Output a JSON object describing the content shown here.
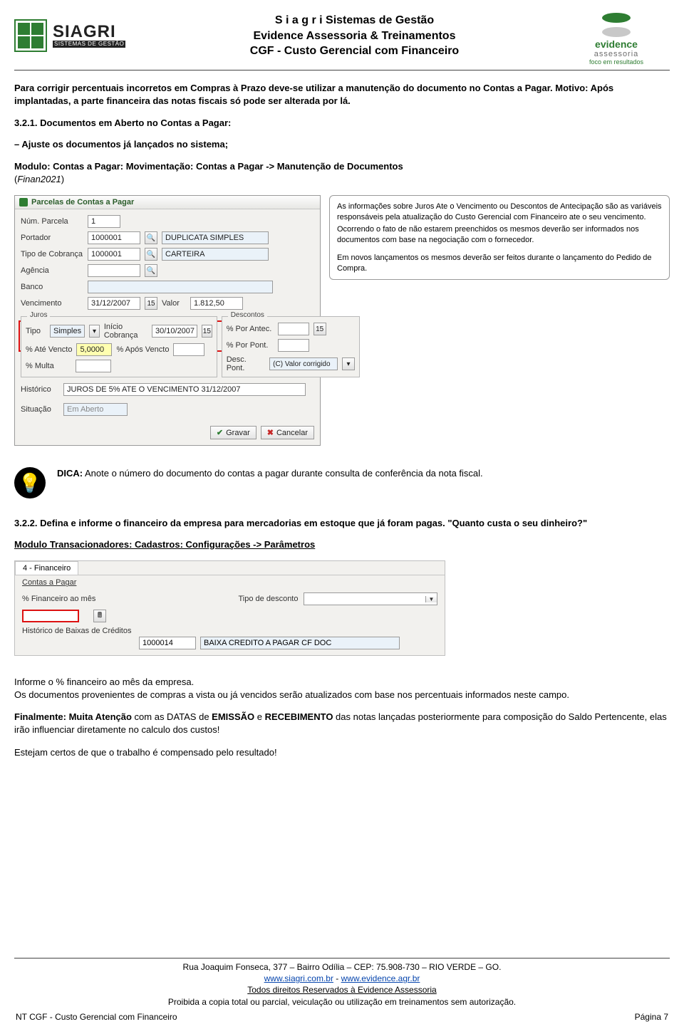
{
  "header": {
    "siagri_name": "SIAGRI",
    "siagri_sub": "SISTEMAS DE GESTÃO",
    "line1": "S i a g r i Sistemas de Gestão",
    "line2": "Evidence Assessoria & Treinamentos",
    "line3": "CGF - Custo Gerencial com Financeiro",
    "evidence_name": "evidence",
    "evidence_sub": "assessoria",
    "evidence_tag": "foco em resultados"
  },
  "intro": {
    "para1": "Para corrigir percentuais incorretos em Compras à Prazo deve-se utilizar a manutenção do documento no Contas a Pagar. Motivo: Após implantadas, a parte financeira das notas fiscais só pode ser alterada por lá."
  },
  "sec321": {
    "title": "3.2.1. Documentos em Aberto no Contas a Pagar:",
    "dash": "– Ajuste os documentos já lançados no sistema;",
    "nav_pre": "Modulo: Contas a Pagar: Movimentação: Contas a Pagar -> Manutenção de Documentos",
    "nav_code": "(",
    "nav_code2": "Finan2021",
    "nav_code3": ")"
  },
  "win1": {
    "title": "Parcelas de Contas a Pagar",
    "labels": {
      "num_parcela": "Núm. Parcela",
      "portador": "Portador",
      "tipo_cobranca": "Tipo de Cobrança",
      "agencia": "Agência",
      "banco": "Banco",
      "vencimento": "Vencimento",
      "valor": "Valor",
      "juros": "Juros",
      "descontos": "Descontos",
      "tipo": "Tipo",
      "inicio_cobranca": "Início Cobrança",
      "por_antec": "% Por Antec.",
      "ate_vencto": "% Até Vencto",
      "apos_vencto": "% Após Vencto",
      "por_pont": "% Por Pont.",
      "multa": "% Multa",
      "desc_pont": "Desc. Pont.",
      "historico": "Histórico",
      "situacao": "Situação"
    },
    "values": {
      "num_parcela": "1",
      "portador": "1000001",
      "portador_desc": "DUPLICATA SIMPLES",
      "tipo_cobranca": "1000001",
      "tipo_cobranca_desc": "CARTEIRA",
      "agencia": "",
      "banco": "",
      "vencimento": "31/12/2007",
      "valor": "1.812,50",
      "tipo": "Simples",
      "inicio_cobranca": "30/10/2007",
      "ate_vencto": "5,0000",
      "apos_vencto": "",
      "multa": "",
      "desc_pont": "(C) Valor corrigido",
      "historico": "JUROS DE 5% ATE O VENCIMENTO 31/12/2007",
      "situacao": "Em Aberto"
    },
    "buttons": {
      "gravar": "Gravar",
      "cancelar": "Cancelar"
    }
  },
  "callout": {
    "p1": "As informações sobre Juros Ate o Vencimento ou Descontos de Antecipação são as variáveis responsáveis pela atualização do Custo Gerencial com Financeiro ate o seu vencimento.",
    "p2": "Ocorrendo o fato de não estarem preenchidos os mesmos deverão ser informados nos documentos com base na negociação com o fornecedor.",
    "p3": "Em novos lançamentos os mesmos deverão ser feitos durante o lançamento do Pedido de Compra."
  },
  "tip": {
    "label": "DICA:",
    "text": " Anote o número do documento do contas a pagar durante consulta de conferência da nota fiscal."
  },
  "sec322": {
    "title": "3.2.2. Defina e informe o financeiro da empresa para mercadorias em estoque que já foram pagas. \"Quanto custa o seu dinheiro?\"",
    "nav": "Modulo Transacionadores: Cadastros: Configurações -> Parâmetros"
  },
  "win2": {
    "tab": "4 - Financeiro",
    "cap": "Contas a Pagar",
    "labels": {
      "perc_fin": "% Financeiro ao mês",
      "tipo_desc": "Tipo de desconto",
      "hist_baixas": "Histórico de Baixas de Créditos"
    },
    "values": {
      "perc_fin": "",
      "tipo_desc": "",
      "hist_baixas": "1000014",
      "hist_baixas_desc": "BAIXA CREDITO A PAGAR CF DOC"
    }
  },
  "closing": {
    "p1": "Informe o % financeiro ao mês da empresa.",
    "p2": "Os documentos provenientes de compras a vista ou já vencidos serão atualizados com base nos percentuais informados neste campo.",
    "p3a": "Finalmente: Muita Atenção",
    "p3b": " com as DATAS de ",
    "p3c": "EMISSÃO",
    "p3d": " e ",
    "p3e": "RECEBIMENTO",
    "p3f": " das notas lançadas posteriormente para composição do Saldo Pertencente, elas irão influenciar diretamente no calculo dos custos!",
    "p4": "Estejam certos de que o trabalho é compensado pelo resultado!"
  },
  "footer": {
    "addr": "Rua Joaquim Fonseca, 377 – Bairro Odília – CEP: 75.908-730 – RIO VERDE – GO.",
    "url1": "www.siagri.com.br",
    "sep": " - ",
    "url2": "www.evidence.agr.br",
    "rights": "Todos direitos Reservados à Evidence Assessoria",
    "warn": "Proibida a copia total ou parcial, veiculação ou utilização em treinamentos sem autorização.",
    "left": "NT CGF - Custo Gerencial com Financeiro",
    "right": "Página 7"
  }
}
